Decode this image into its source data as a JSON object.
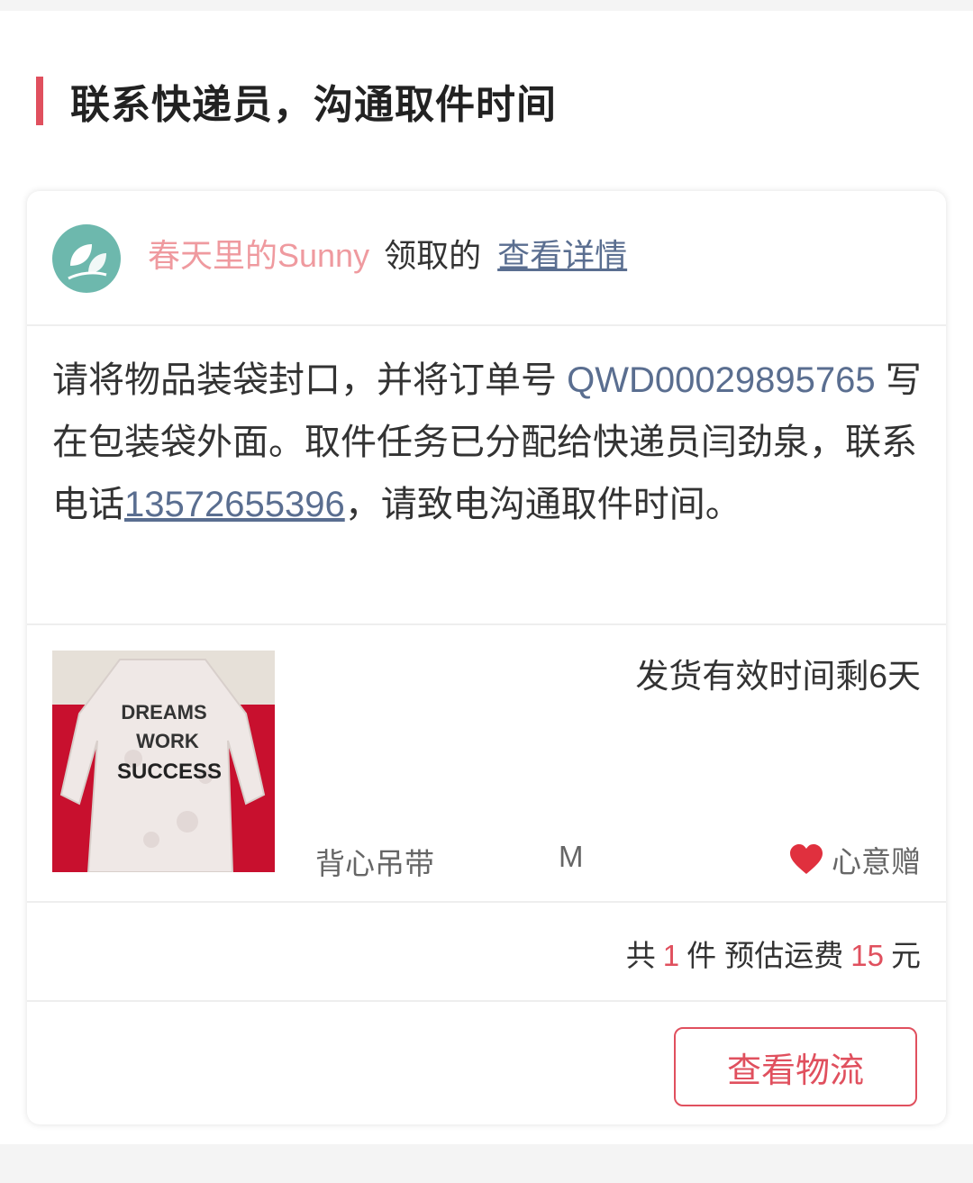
{
  "section": {
    "title": "联系快递员，沟通取件时间"
  },
  "card": {
    "user_name": "春天里的Sunny",
    "claimed_text": "领取的",
    "detail_link": "查看详情",
    "message": {
      "part1": "请将物品装袋封口，并将订单号 ",
      "order_number": "QWD00029895765",
      "part2": " 写在包装袋外面。取件任务已分配给快递员闫劲泉，联系电话",
      "phone": "13572655396",
      "part3": "，请致电沟通取件时间。"
    },
    "item": {
      "image_alt": "DREAMS WORK SUCCESS",
      "image_lines": [
        "DREAMS",
        "WORK",
        "SUCCESS"
      ],
      "deadline": "发货有效时间剩6天",
      "name": "背心吊带",
      "size": "M",
      "gift_label": "心意赠"
    },
    "summary": {
      "prefix": "共",
      "count": "1",
      "unit_shipping": "件 预估运费",
      "fee": "15",
      "currency": "元"
    },
    "button": {
      "label": "查看物流"
    }
  },
  "colors": {
    "accent": "#e0505e",
    "link": "#5a6e90",
    "username": "#ef9a9f",
    "avatar": "#6db8ad"
  }
}
